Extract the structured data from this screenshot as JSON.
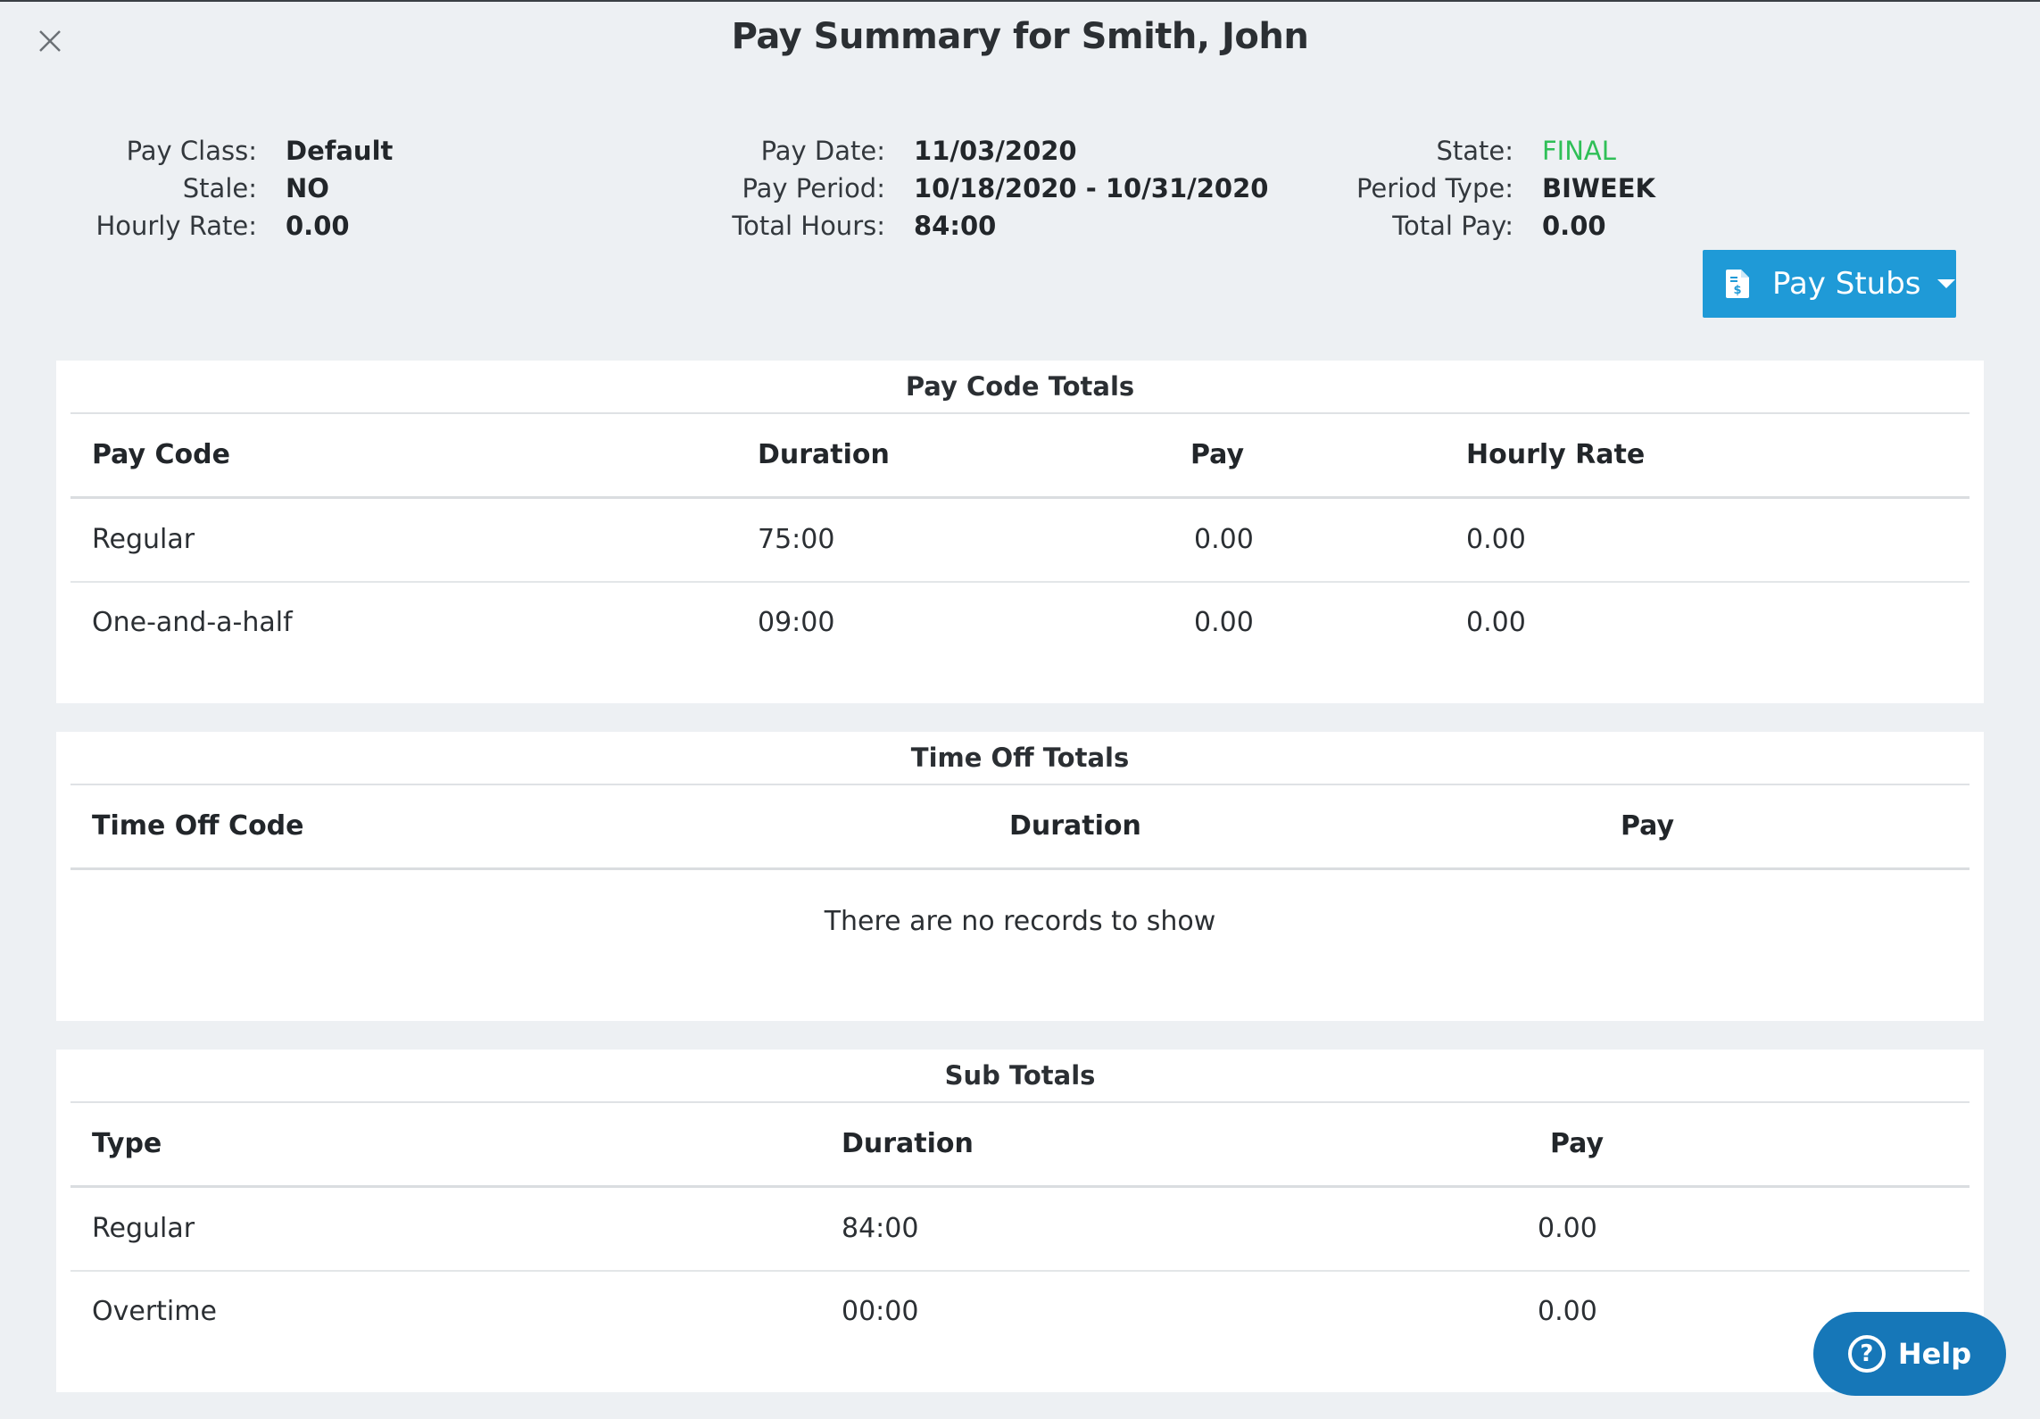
{
  "title": "Pay Summary for Smith, John",
  "info": {
    "col1": [
      {
        "label": "Pay Class:",
        "value": "Default"
      },
      {
        "label": "Stale:",
        "value": "NO"
      },
      {
        "label": "Hourly Rate:",
        "value": "0.00"
      }
    ],
    "col2": [
      {
        "label": "Pay Date:",
        "value": "11/03/2020"
      },
      {
        "label": "Pay Period:",
        "value": "10/18/2020 - 10/31/2020"
      },
      {
        "label": "Total Hours:",
        "value": "84:00"
      }
    ],
    "col3": [
      {
        "label": "State:",
        "value": "FINAL"
      },
      {
        "label": "Period Type:",
        "value": "BIWEEK"
      },
      {
        "label": "Total Pay:",
        "value": "0.00"
      }
    ]
  },
  "state_color": "#2fbf57",
  "pay_stubs_button": {
    "label": "Pay Stubs",
    "icon": "document-dollar-icon"
  },
  "pay_code_totals": {
    "title": "Pay Code Totals",
    "headers": [
      "Pay Code",
      "Duration",
      "Pay",
      "Hourly Rate"
    ],
    "rows": [
      [
        "Regular",
        "75:00",
        "0.00",
        "0.00"
      ],
      [
        "One-and-a-half",
        "09:00",
        "0.00",
        "0.00"
      ]
    ]
  },
  "time_off_totals": {
    "title": "Time Off Totals",
    "headers": [
      "Time Off Code",
      "Duration",
      "Pay"
    ],
    "empty_message": "There are no records to show"
  },
  "sub_totals": {
    "title": "Sub Totals",
    "headers": [
      "Type",
      "Duration",
      "Pay"
    ],
    "rows": [
      [
        "Regular",
        "84:00",
        "0.00"
      ],
      [
        "Overtime",
        "00:00",
        "0.00"
      ]
    ]
  },
  "help_button": {
    "label": "Help",
    "icon": "question-circle-icon"
  },
  "accent_color": "#1f9ad7"
}
